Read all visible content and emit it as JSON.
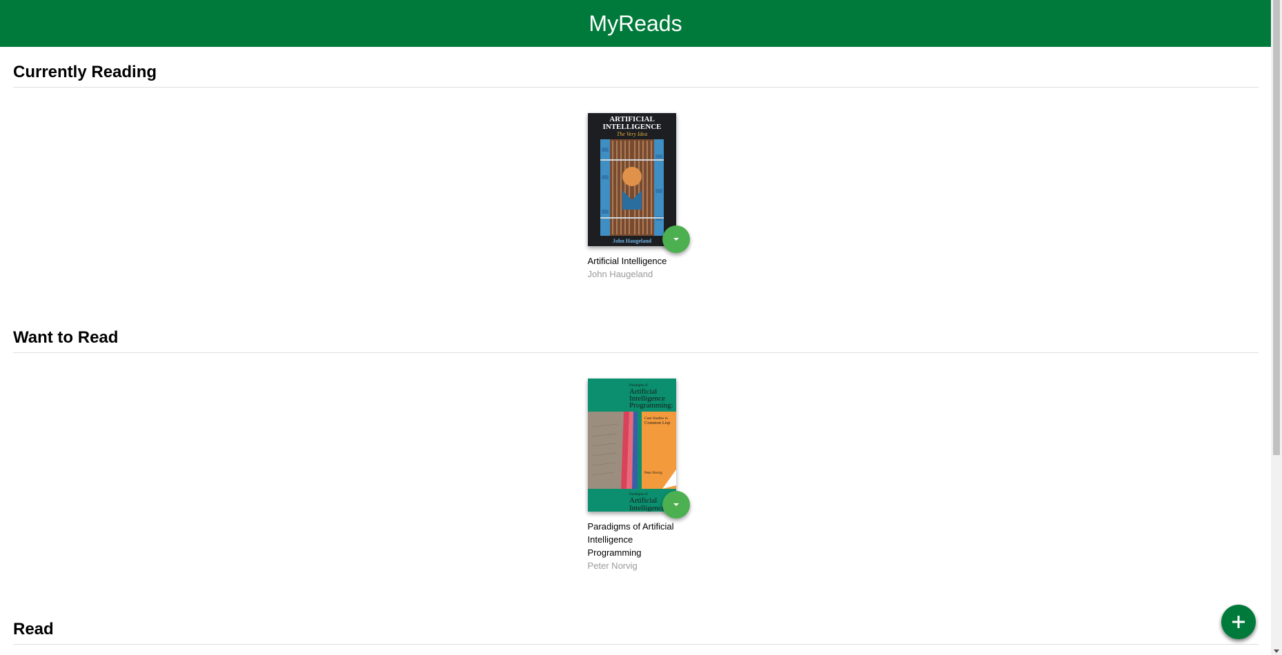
{
  "app": {
    "title": "MyReads"
  },
  "shelves": [
    {
      "title": "Currently Reading",
      "books": [
        {
          "title": "Artificial Intelligence",
          "authors": "John Haugeland",
          "cover": {
            "heading_line1": "ARTIFICIAL",
            "heading_line2": "INTELLIGENCE",
            "subtitle": "The Very Idea",
            "author": "John Haugeland"
          }
        }
      ]
    },
    {
      "title": "Want to Read",
      "books": [
        {
          "title": "Paradigms of Artificial Intelligence Programming",
          "authors": "Peter Norvig",
          "cover": {
            "pre": "Paradigms of",
            "heading_line1": "Artificial",
            "heading_line2": "Intelligence",
            "heading_line3": "Programming:",
            "subtitle_line1": "Case Studies in",
            "subtitle_line2": "Common Lisp",
            "author": "Peter Norvig",
            "footer_pre": "Paradigms of",
            "footer_line1": "Artificial",
            "footer_line2": "Intelligence"
          }
        }
      ]
    },
    {
      "title": "Read",
      "books": []
    }
  ],
  "colors": {
    "header": "#007a3a",
    "shelf_changer": "#4caf50",
    "add_button": "#007a3a",
    "author_text": "#999999"
  },
  "icons": {
    "shelf_changer": "caret-down-icon",
    "add_button": "plus-icon"
  }
}
